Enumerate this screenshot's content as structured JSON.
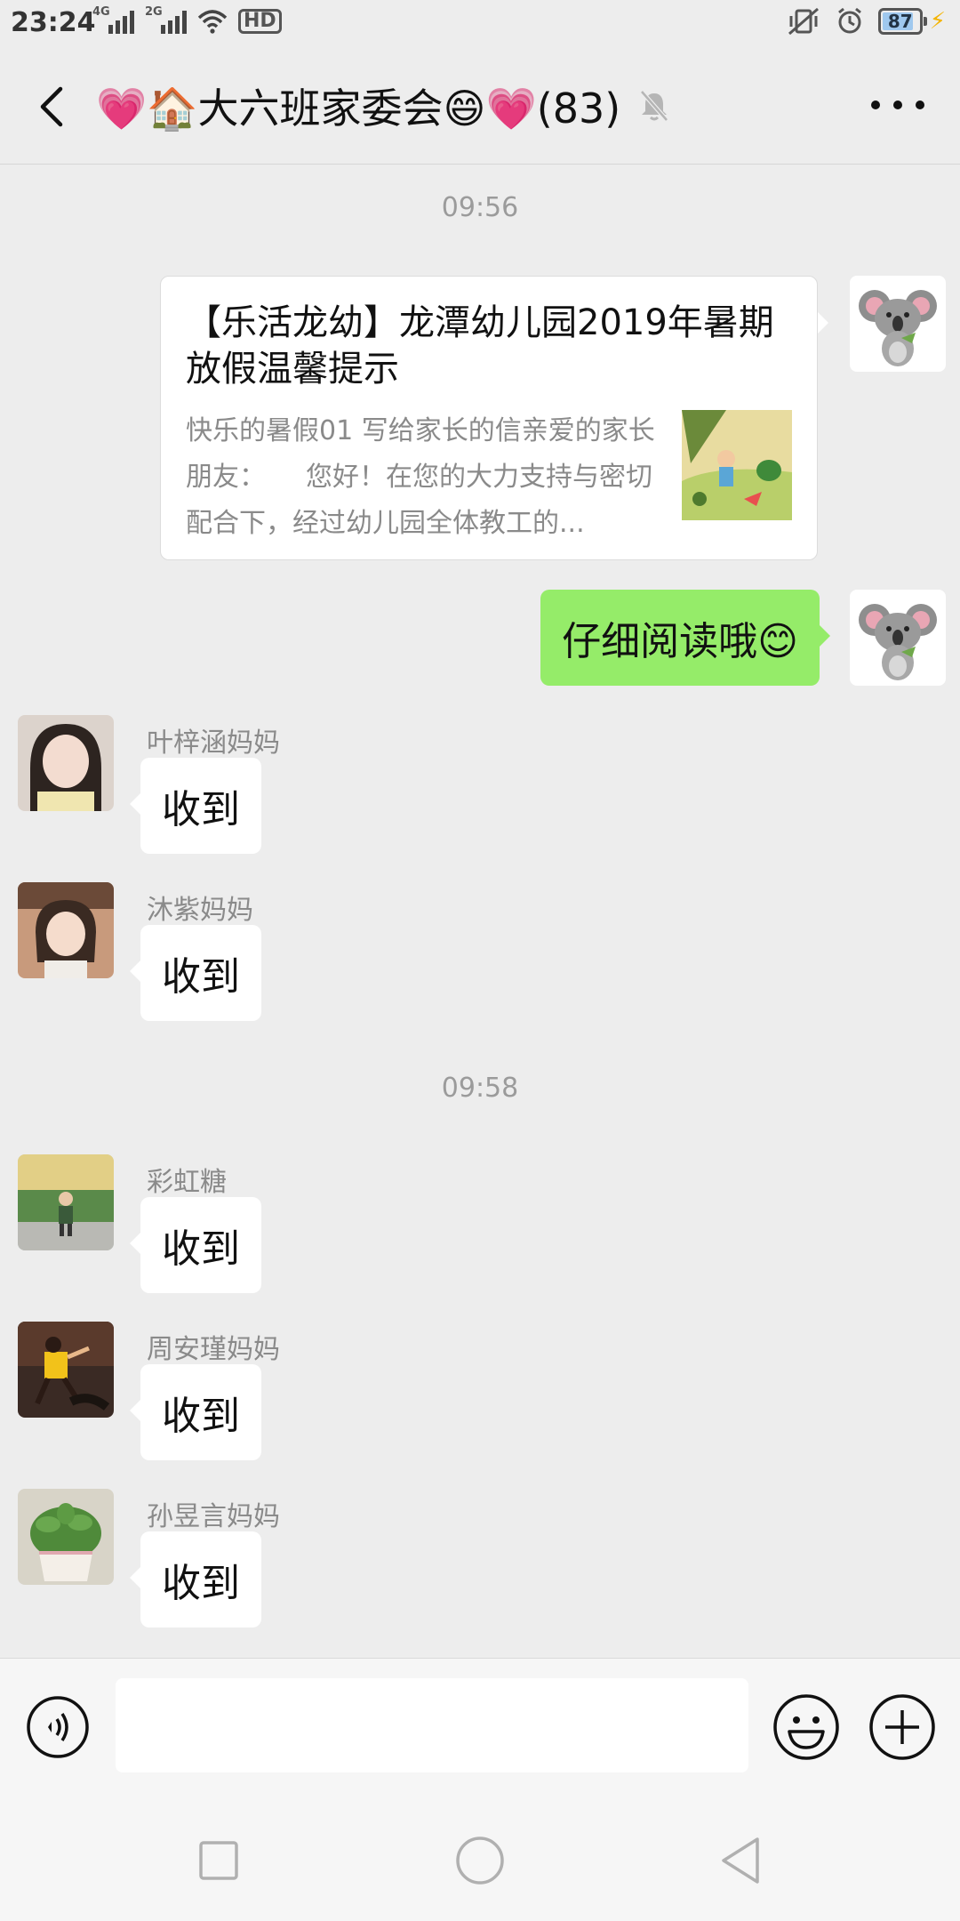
{
  "status_bar": {
    "time": "23:24",
    "signal_1": "4G",
    "signal_2": "2G",
    "hd": "HD",
    "battery": "87",
    "battery_fraction": 0.87
  },
  "header": {
    "title": "💗🏠大六班家委会😄💗(83)",
    "icons": {
      "back": "back-arrow-icon",
      "mute": "muted-bell-icon",
      "more": "more-dots-icon"
    }
  },
  "chat": {
    "time_1": "09:56",
    "link_card": {
      "title": "【乐活龙幼】龙潭幼儿园2019年暑期放假温馨提示",
      "description": "快乐的暑假01 写给家长的信亲爱的家长朋友：　　您好！在您的大力支持与密切配合下，经过幼儿园全体教工的..."
    },
    "self_message": "仔细阅读哦😊",
    "time_2": "09:58",
    "group_1": [
      {
        "name": "叶梓涵妈妈",
        "text": "收到"
      },
      {
        "name": "沐紫妈妈",
        "text": "收到"
      }
    ],
    "group_2": [
      {
        "name": "彩虹糖",
        "text": "收到"
      },
      {
        "name": "周安瑾妈妈",
        "text": "收到"
      },
      {
        "name": "孙昱言妈妈",
        "text": "收到"
      }
    ]
  },
  "input_bar": {
    "placeholder": "",
    "icons": {
      "voice": "voice-icon",
      "emoji": "emoji-icon",
      "plus": "plus-icon"
    }
  },
  "nav_bar": {
    "icons": [
      "recents-square-icon",
      "home-circle-icon",
      "back-triangle-icon"
    ]
  },
  "colors": {
    "self_bubble": "#95ec69",
    "background": "#ededed",
    "accent_charge": "#f4b400"
  }
}
